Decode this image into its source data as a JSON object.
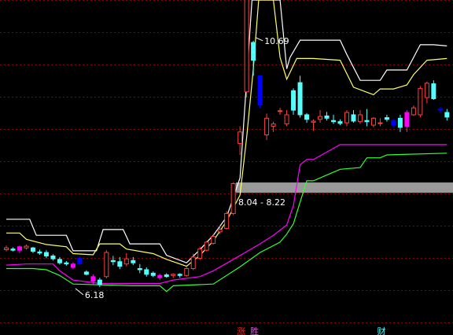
{
  "chart_data": {
    "type": "candlestick",
    "title": "",
    "ylim": [
      5.85,
      11.4
    ],
    "grid": true,
    "colors": {
      "background": "#000000",
      "grid": "#8b0000",
      "up": "#ff4040",
      "down": "#54ffff",
      "blue_candle": "#0000ff",
      "magenta_candle": "#ff00ff",
      "upper_band": "#ffffff",
      "mid_band": "#ffff66",
      "low_band": "#ff00ff",
      "bottom_band": "#33ff33",
      "zone": "#999999"
    },
    "candles": [
      {
        "o": 7.05,
        "h": 7.12,
        "l": 7.02,
        "c": 7.08
      },
      {
        "o": 7.06,
        "h": 7.09,
        "l": 7.02,
        "c": 7.04
      },
      {
        "o": 7.04,
        "h": 7.12,
        "l": 6.99,
        "c": 7.1,
        "color": "magenta"
      },
      {
        "o": 7.08,
        "h": 7.14,
        "l": 7.05,
        "c": 7.11
      },
      {
        "o": 7.08,
        "h": 7.1,
        "l": 6.99,
        "c": 7.02
      },
      {
        "o": 7.01,
        "h": 7.05,
        "l": 6.96,
        "c": 6.99
      },
      {
        "o": 7.0,
        "h": 7.04,
        "l": 6.9,
        "c": 6.94
      },
      {
        "o": 6.94,
        "h": 6.97,
        "l": 6.86,
        "c": 6.89
      },
      {
        "o": 6.88,
        "h": 6.92,
        "l": 6.79,
        "c": 6.82
      },
      {
        "o": 6.82,
        "h": 6.85,
        "l": 6.77,
        "c": 6.8
      },
      {
        "o": 6.8,
        "h": 6.83,
        "l": 6.71,
        "c": 6.74,
        "color": "magenta"
      },
      {
        "o": 6.9,
        "h": 6.94,
        "l": 6.78,
        "c": 6.8,
        "color": "blue"
      },
      {
        "o": 6.66,
        "h": 6.69,
        "l": 6.6,
        "c": 6.62
      },
      {
        "o": 6.58,
        "h": 6.62,
        "l": 6.45,
        "c": 6.5,
        "color": "magenta"
      },
      {
        "o": 6.52,
        "h": 6.56,
        "l": 6.4,
        "c": 6.44
      },
      {
        "o": 6.58,
        "h": 7.04,
        "l": 6.55,
        "c": 7.0
      },
      {
        "o": 6.86,
        "h": 6.94,
        "l": 6.78,
        "c": 6.84
      },
      {
        "o": 6.84,
        "h": 6.92,
        "l": 6.71,
        "c": 6.76
      },
      {
        "o": 6.8,
        "h": 6.99,
        "l": 6.76,
        "c": 6.89
      },
      {
        "o": 6.86,
        "h": 6.92,
        "l": 6.78,
        "c": 6.82
      },
      {
        "o": 6.72,
        "h": 6.8,
        "l": 6.64,
        "c": 6.7
      },
      {
        "o": 6.7,
        "h": 6.74,
        "l": 6.58,
        "c": 6.62
      },
      {
        "o": 6.64,
        "h": 6.67,
        "l": 6.57,
        "c": 6.6
      },
      {
        "o": 6.6,
        "h": 6.63,
        "l": 6.52,
        "c": 6.56,
        "color": "magenta"
      },
      {
        "o": 6.61,
        "h": 6.64,
        "l": 6.56,
        "c": 6.58
      },
      {
        "o": 6.6,
        "h": 6.64,
        "l": 6.56,
        "c": 6.62
      },
      {
        "o": 6.62,
        "h": 6.64,
        "l": 6.56,
        "c": 6.6
      },
      {
        "o": 6.6,
        "h": 6.75,
        "l": 6.58,
        "c": 6.72
      },
      {
        "o": 6.72,
        "h": 6.98,
        "l": 6.69,
        "c": 6.92
      },
      {
        "o": 6.9,
        "h": 7.1,
        "l": 6.87,
        "c": 7.06
      },
      {
        "o": 7.04,
        "h": 7.2,
        "l": 7.02,
        "c": 7.18
      },
      {
        "o": 7.16,
        "h": 7.32,
        "l": 7.14,
        "c": 7.28
      },
      {
        "o": 7.36,
        "h": 7.48,
        "l": 7.32,
        "c": 7.4
      },
      {
        "o": 7.42,
        "h": 7.72,
        "l": 7.4,
        "c": 7.68
      },
      {
        "o": 7.68,
        "h": 8.22,
        "l": 7.65,
        "c": 8.2
      },
      {
        "o": 8.9,
        "h": 9.2,
        "l": 8.7,
        "c": 9.1
      },
      {
        "o": 9.8,
        "h": 12.5,
        "l": 9.7,
        "c": 12.4
      },
      {
        "o": 10.66,
        "h": 10.69,
        "l": 10.08,
        "c": 10.35
      },
      {
        "o": 10.08,
        "h": 10.08,
        "l": 9.52,
        "c": 9.57,
        "color": "blue"
      },
      {
        "o": 9.05,
        "h": 9.42,
        "l": 8.96,
        "c": 9.34
      },
      {
        "o": 9.2,
        "h": 9.28,
        "l": 9.1,
        "c": 9.24
      },
      {
        "o": 9.46,
        "h": 9.52,
        "l": 9.4,
        "c": 9.47
      },
      {
        "o": 9.24,
        "h": 9.48,
        "l": 9.2,
        "c": 9.4
      },
      {
        "o": 9.82,
        "h": 9.86,
        "l": 9.4,
        "c": 9.48
      },
      {
        "o": 9.96,
        "h": 10.08,
        "l": 9.35,
        "c": 9.4
      },
      {
        "o": 9.4,
        "h": 9.43,
        "l": 9.26,
        "c": 9.32
      },
      {
        "o": 9.27,
        "h": 9.32,
        "l": 9.12,
        "c": 9.29
      },
      {
        "o": 9.32,
        "h": 9.48,
        "l": 9.26,
        "c": 9.37
      },
      {
        "o": 9.38,
        "h": 9.45,
        "l": 9.3,
        "c": 9.34
      },
      {
        "o": 9.3,
        "h": 9.4,
        "l": 9.24,
        "c": 9.28
      },
      {
        "o": 9.28,
        "h": 9.32,
        "l": 9.22,
        "c": 9.25
      },
      {
        "o": 9.26,
        "h": 9.48,
        "l": 9.2,
        "c": 9.44
      },
      {
        "o": 9.4,
        "h": 9.48,
        "l": 9.26,
        "c": 9.29
      },
      {
        "o": 9.28,
        "h": 9.48,
        "l": 9.24,
        "c": 9.4
      },
      {
        "o": 9.3,
        "h": 9.5,
        "l": 9.2,
        "c": 9.28
      },
      {
        "o": 9.22,
        "h": 9.36,
        "l": 9.18,
        "c": 9.34
      },
      {
        "o": 9.26,
        "h": 9.34,
        "l": 9.2,
        "c": 9.26
      },
      {
        "o": 9.35,
        "h": 9.4,
        "l": 9.28,
        "c": 9.32
      },
      {
        "o": 9.3,
        "h": 9.32,
        "l": 9.18,
        "c": 9.22,
        "color": "blue"
      },
      {
        "o": 9.34,
        "h": 9.4,
        "l": 9.1,
        "c": 9.18
      },
      {
        "o": 9.2,
        "h": 9.48,
        "l": 9.1,
        "c": 9.44,
        "color": "magenta"
      },
      {
        "o": 9.4,
        "h": 9.56,
        "l": 9.38,
        "c": 9.52
      },
      {
        "o": 9.4,
        "h": 9.9,
        "l": 9.36,
        "c": 9.86
      },
      {
        "o": 9.7,
        "h": 9.98,
        "l": 9.6,
        "c": 9.95
      },
      {
        "o": 9.94,
        "h": 10.0,
        "l": 9.66,
        "c": 9.68
      },
      {
        "o": 9.5,
        "h": 9.54,
        "l": 9.42,
        "c": 9.48,
        "color": "blue"
      },
      {
        "o": 9.44,
        "h": 9.5,
        "l": 9.3,
        "c": 9.36
      }
    ],
    "bands": {
      "upper": [
        [
          0,
          7.58
        ],
        [
          3.5,
          7.58
        ],
        [
          4.5,
          7.3
        ],
        [
          9,
          7.3
        ],
        [
          10,
          7.03
        ],
        [
          13.5,
          7.03
        ],
        [
          14.5,
          7.4
        ],
        [
          15.5,
          7.4
        ],
        [
          17.5,
          7.4
        ],
        [
          18.5,
          7.15
        ],
        [
          23,
          7.15
        ],
        [
          24,
          6.95
        ],
        [
          27,
          6.82
        ],
        [
          29,
          7.05
        ],
        [
          31,
          7.3
        ],
        [
          33,
          7.62
        ],
        [
          35,
          8.3
        ],
        [
          36,
          10.0
        ],
        [
          36.8,
          11.4
        ],
        [
          41,
          11.4
        ],
        [
          42,
          10.2
        ],
        [
          42.5,
          10.4
        ],
        [
          44,
          10.7
        ],
        [
          50,
          10.7
        ],
        [
          51,
          10.45
        ],
        [
          53,
          10.0
        ],
        [
          56,
          10.0
        ],
        [
          57,
          10.18
        ],
        [
          60,
          10.18
        ],
        [
          61,
          10.4
        ],
        [
          62,
          10.62
        ],
        [
          64,
          10.62
        ],
        [
          66,
          10.6
        ]
      ],
      "mid": [
        [
          0,
          7.34
        ],
        [
          2,
          7.34
        ],
        [
          3,
          7.23
        ],
        [
          6,
          7.14
        ],
        [
          9,
          7.1
        ],
        [
          10,
          6.98
        ],
        [
          13,
          6.96
        ],
        [
          14,
          7.15
        ],
        [
          17,
          7.15
        ],
        [
          18,
          7.06
        ],
        [
          22,
          6.98
        ],
        [
          24,
          6.88
        ],
        [
          27,
          6.76
        ],
        [
          29,
          6.95
        ],
        [
          31,
          7.2
        ],
        [
          33,
          7.55
        ],
        [
          35,
          8.0
        ],
        [
          36,
          9.0
        ],
        [
          37,
          10.2
        ],
        [
          37.8,
          11.4
        ],
        [
          40,
          11.4
        ],
        [
          41,
          10.4
        ],
        [
          42,
          10.02
        ],
        [
          43.5,
          10.38
        ],
        [
          46,
          10.38
        ],
        [
          50,
          10.35
        ],
        [
          52,
          9.88
        ],
        [
          55,
          9.75
        ],
        [
          56,
          9.85
        ],
        [
          58,
          9.85
        ],
        [
          60,
          9.92
        ],
        [
          61,
          10.1
        ],
        [
          63,
          10.35
        ],
        [
          66,
          10.38
        ]
      ],
      "low": [
        [
          0,
          6.78
        ],
        [
          3,
          6.8
        ],
        [
          7,
          6.8
        ],
        [
          8,
          6.68
        ],
        [
          10,
          6.52
        ],
        [
          14,
          6.46
        ],
        [
          23,
          6.46
        ],
        [
          25,
          6.52
        ],
        [
          29,
          6.58
        ],
        [
          31,
          6.68
        ],
        [
          34,
          6.88
        ],
        [
          38,
          7.15
        ],
        [
          40,
          7.3
        ],
        [
          42,
          7.48
        ],
        [
          43,
          7.82
        ],
        [
          44,
          8.53
        ],
        [
          45,
          8.62
        ],
        [
          46,
          8.62
        ],
        [
          48,
          8.75
        ],
        [
          50,
          8.88
        ],
        [
          66,
          8.88
        ]
      ],
      "bottom": [
        [
          0,
          6.72
        ],
        [
          4,
          6.72
        ],
        [
          6,
          6.7
        ],
        [
          8,
          6.6
        ],
        [
          10,
          6.45
        ],
        [
          19,
          6.42
        ],
        [
          23,
          6.42
        ],
        [
          24,
          6.32
        ],
        [
          25,
          6.42
        ],
        [
          31,
          6.45
        ],
        [
          35,
          6.75
        ],
        [
          38,
          7.0
        ],
        [
          41,
          7.18
        ],
        [
          42,
          7.32
        ],
        [
          43,
          7.5
        ],
        [
          44,
          7.88
        ],
        [
          45,
          8.25
        ],
        [
          46,
          8.25
        ],
        [
          48,
          8.35
        ],
        [
          50,
          8.45
        ],
        [
          53,
          8.48
        ],
        [
          54,
          8.65
        ],
        [
          56,
          8.65
        ],
        [
          57,
          8.7
        ],
        [
          66,
          8.73
        ]
      ]
    },
    "zone": {
      "low": 8.04,
      "high": 8.22,
      "label": "8.04 - 8.22"
    },
    "annotations": [
      {
        "text": "10.69",
        "x": 37,
        "y": 10.69
      },
      {
        "text": "6.18",
        "x": 10,
        "y": 6.4
      }
    ],
    "bottom_markers": [
      {
        "text": "涨",
        "x": 35,
        "color": "#ff2020"
      },
      {
        "text": "胜",
        "x": 37,
        "color": "#ff40ff"
      },
      {
        "text": "财",
        "x": 56,
        "color": "#54ffff"
      }
    ]
  }
}
